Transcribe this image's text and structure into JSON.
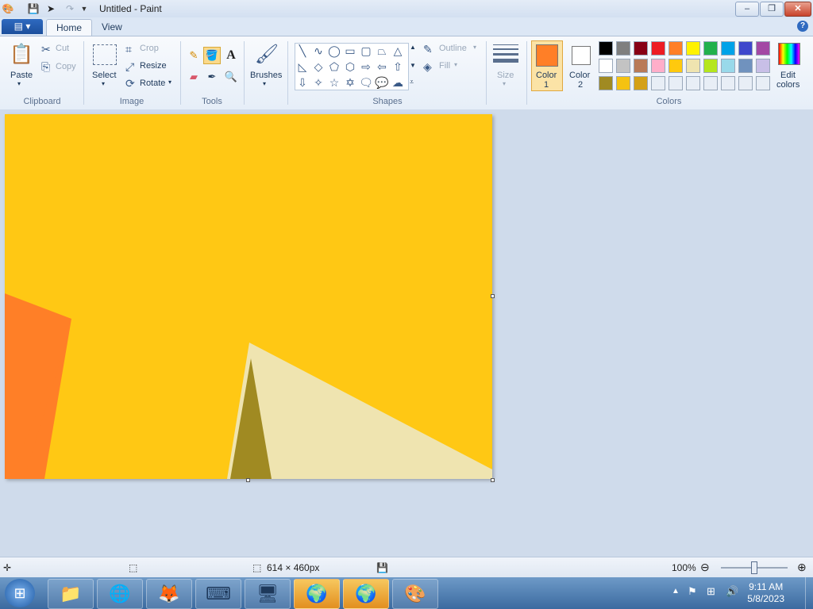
{
  "window": {
    "title": "Untitled - Paint"
  },
  "quick_access": {
    "save_icon": "save-icon",
    "undo_icon": "undo-icon",
    "redo_icon": "redo-icon"
  },
  "tabs": {
    "home": "Home",
    "view": "View"
  },
  "clipboard": {
    "paste": "Paste",
    "cut": "Cut",
    "copy": "Copy",
    "label": "Clipboard"
  },
  "image": {
    "select": "Select",
    "crop": "Crop",
    "resize": "Resize",
    "rotate": "Rotate",
    "label": "Image"
  },
  "tools": {
    "label": "Tools"
  },
  "brushes": {
    "label": "Brushes"
  },
  "shapes": {
    "outline": "Outline",
    "fill": "Fill",
    "label": "Shapes"
  },
  "size": {
    "label": "Size"
  },
  "colors": {
    "color1_label": "Color",
    "color1_num": "1",
    "color2_label": "Color",
    "color2_num": "2",
    "edit_colors": "Edit",
    "edit_colors_2": "colors",
    "label": "Colors",
    "color1": "#ff7f27",
    "color2": "#ffffff",
    "palette": [
      "#000000",
      "#7f7f7f",
      "#880015",
      "#ed1c24",
      "#ff7f27",
      "#fff200",
      "#22b14c",
      "#00a2e8",
      "#3f48cc",
      "#a349a4",
      "#ffffff",
      "#c3c3c3",
      "#b97a57",
      "#ffaec9",
      "#ffc90e",
      "#efe4b0",
      "#b5e61d",
      "#99d9ea",
      "#7092be",
      "#c8bfe7",
      "#a08a22",
      "#f5c211",
      "#d4a017",
      "#e8eef6",
      "#e8eef6",
      "#e8eef6",
      "#e8eef6",
      "#e8eef6",
      "#e8eef6",
      "#e8eef6"
    ]
  },
  "canvas_colors": {
    "background": "#ffc814",
    "orange": "#ff7f27",
    "olive": "#a08a22",
    "cream": "#efe4b0"
  },
  "status": {
    "dimensions": "614 × 460px",
    "zoom": "100%"
  },
  "taskbar": {
    "time": "9:11 AM",
    "date": "5/8/2023"
  }
}
